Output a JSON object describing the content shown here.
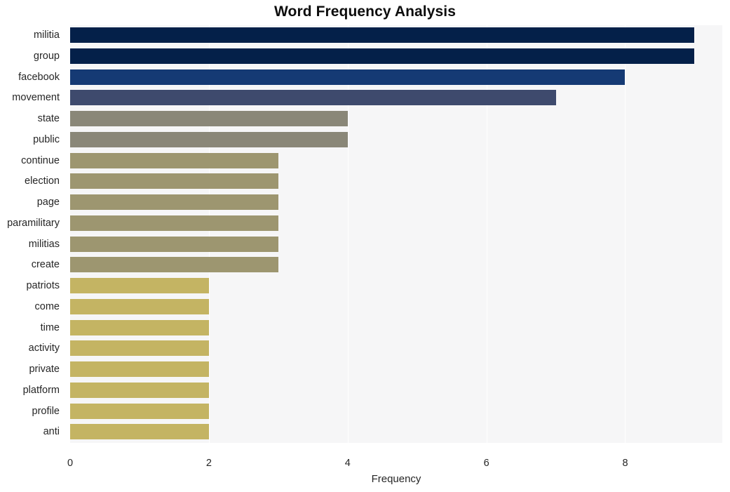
{
  "chart_data": {
    "type": "bar",
    "orientation": "horizontal",
    "title": "Word Frequency Analysis",
    "xlabel": "Frequency",
    "ylabel": "",
    "categories": [
      "militia",
      "group",
      "facebook",
      "movement",
      "state",
      "public",
      "continue",
      "election",
      "page",
      "paramilitary",
      "militias",
      "create",
      "patriots",
      "come",
      "time",
      "activity",
      "private",
      "platform",
      "profile",
      "anti"
    ],
    "values": [
      9,
      9,
      8,
      7,
      4,
      4,
      3,
      3,
      3,
      3,
      3,
      3,
      2,
      2,
      2,
      2,
      2,
      2,
      2,
      2
    ],
    "bar_colors": [
      "#042049",
      "#042049",
      "#153a74",
      "#3e4a6d",
      "#8a8778",
      "#8a8778",
      "#9d9670",
      "#9d9670",
      "#9d9670",
      "#9d9670",
      "#9d9670",
      "#9d9670",
      "#c4b463",
      "#c4b463",
      "#c4b463",
      "#c4b463",
      "#c4b463",
      "#c4b463",
      "#c4b463",
      "#c4b463"
    ],
    "xticks": [
      0,
      2,
      4,
      6,
      8
    ],
    "xtick_labels": [
      "0",
      "2",
      "4",
      "6",
      "8"
    ],
    "xlim": [
      0,
      9.4
    ],
    "ylim_count": 20,
    "grid": true,
    "grid_axis": "x",
    "legend": null,
    "plot_background": "#f6f6f7",
    "figure_background": "#ffffff",
    "gridline_color": "#ffffff",
    "text_color": "#262626",
    "title_color": "#0d0d0d"
  }
}
